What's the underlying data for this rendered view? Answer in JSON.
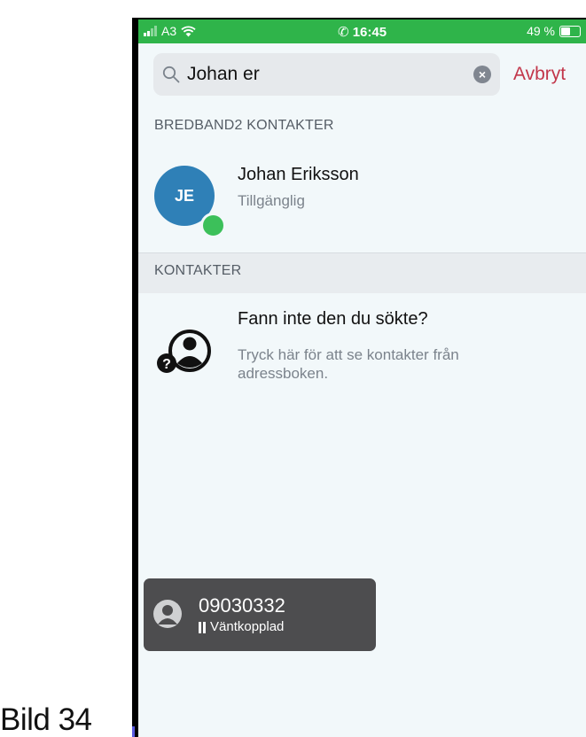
{
  "caption": "Bild 34",
  "status_bar": {
    "carrier": "A3",
    "time": "16:45",
    "battery": "49 %",
    "color": "#2fb44a"
  },
  "search": {
    "value": "Johan er",
    "cancel_label": "Avbryt"
  },
  "sections": {
    "bredband2": {
      "header": "BREDBAND2 KONTAKTER",
      "contact": {
        "initials": "JE",
        "name": "Johan Eriksson",
        "status": "Tillgänglig",
        "avatar_color": "#2f80b7",
        "presence_color": "#3cc05a"
      }
    },
    "contacts": {
      "header": "KONTAKTER",
      "not_found_title": "Fann inte den du sökte?",
      "not_found_description": "Tryck här för att se kontakter från adressboken."
    }
  },
  "call_toast": {
    "number": "09030332",
    "state": "Väntkopplad"
  },
  "accent_color": "#c2364a"
}
